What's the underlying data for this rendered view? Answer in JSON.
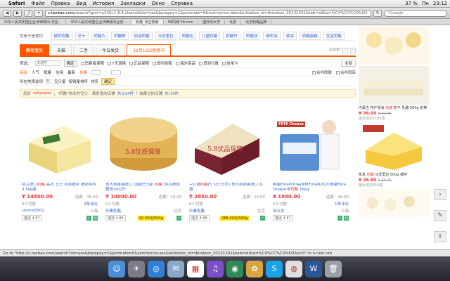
{
  "menubar": {
    "app": "Safari",
    "items": [
      "Файл",
      "Правка",
      "Вид",
      "История",
      "Закладки",
      "Окно",
      "Справка"
    ],
    "status": [
      "37 %",
      "Пн",
      "23:12"
    ]
  },
  "browser": {
    "page_title": "奶酪_淘宝搜索",
    "url_domain": "s.taobao.com",
    "url_rest": "/search?spm=a230r.1.8.6.clzanyl&ds=yes&bprepay=1&promote=0&sort=price-desc&initiative_id=tbindexz_20131201&tab=all&q=%C4%CC%C0%D2",
    "search_placeholder": "Google",
    "tabs": [
      "中华人民共和国企业法律顾问 淘宝...",
      "中华人民共和国企业法律顾问业务...",
      "奶酪_淘宝搜索",
      "58同城 58.com",
      "国外的大学",
      "北京",
      "北京奶酪品牌"
    ]
  },
  "categories": {
    "label": "您是不是想找：",
    "items": [
      "披萨奶酪",
      "芝士",
      "奶酪片",
      "奶酪棒",
      "奶油奶酪",
      "马苏里拉",
      "奶酪包",
      "儿童奶酪",
      "奶酪丹",
      "奶酪球",
      "稀奶油",
      "黄油",
      "奶酪蛋糕",
      "宝宝奶酪"
    ]
  },
  "tabs": {
    "items": [
      "所有宝贝",
      "天猫",
      "二手",
      "今日发货",
      "12月12日购物节"
    ],
    "pager": "1/100"
  },
  "filter1": {
    "label": "筛选：",
    "placeholder": "关键字",
    "ok": "确定",
    "checks": [
      "消费者保障",
      "7天退换",
      "正品保障",
      "即时到账",
      "海外商品",
      "货到付款",
      "信用卡"
    ],
    "select": "全部"
  },
  "filter2": {
    "items": [
      "综合",
      "人气",
      "销量",
      "信用",
      "最新"
    ],
    "price_label": "价格",
    "options": [
      "合并同款",
      "合并同店"
    ]
  },
  "filter3": {
    "label": "所在地筛选项",
    "value": "3",
    "items": [
      "宝贝量",
      "按销量排序",
      "排序"
    ],
    "ok": "确定"
  },
  "notice": {
    "text1": "您好",
    "user": "rallytaker",
    "text2": "，\"奶酪\"相关的宝贝：满意度的店铺",
    "count1": "共计24件",
    "text3": "收藏过的店铺",
    "count2": "共计0件"
  },
  "products": [
    {
      "title_pre": "荷兰进口",
      "title_hl": "奶酪",
      "title_post": " 高达 芝士 拉丝披萨 披萨原料 3.5kg装",
      "price": "¥ 14800.00",
      "shipping": "运费：35.00",
      "sold": "0人付款",
      "reviews": "3条评论",
      "shop": "chenyl0902",
      "location": "上海",
      "rating": "4.87",
      "badge": "",
      "img_text": ""
    },
    {
      "title_pre": "意大利原装进口 顶级巴马臣 ",
      "title_hl": "奶酪",
      "title_post": " 36月熟成 整块24公斤",
      "price": "¥ 10000.00",
      "shipping": "运费：10.00",
      "sold": "0人付款",
      "reviews": "",
      "shop": "乐雅乳酪",
      "location": "北京",
      "rating": "4.88",
      "badge": "92.59元/500g",
      "img_text": "5.8优质保障"
    },
    {
      "title_pre": "+红酒",
      "title_hl": "奶酪",
      "title_post": "(5 公斤左右) 意大利原装进口 红酒",
      "price": "¥ 2850.00",
      "shipping": "运费：10.00",
      "sold": "0人付款",
      "reviews": "",
      "shop": "乐雅乳酪",
      "location": "北京",
      "rating": "4.88",
      "badge": "285.00元/500g",
      "img_text": "5.8优品保障"
    },
    {
      "title_pre": "希腊FetaPDO高等MEVGALIKI大桶装Feta cheese羊",
      "title_hl": "奶酪",
      "title_post": " 16kg",
      "price": "¥ 1980.00",
      "shipping": "运费：44.00",
      "sold": "0人付款",
      "reviews": "1条评论",
      "shop": "何以志",
      "location": "上海",
      "rating": "4.87",
      "badge": "",
      "img_text": "FETA Cheese"
    }
  ],
  "sidebar_ads": [
    {
      "title_pre": "内蒙古 特产零食 ",
      "title_hl": "奶酪",
      "title_post": " 奶干 乳酪 500g 奶棒",
      "price": "¥ 36.00",
      "old_price": "¥ 72.00",
      "sold": "最近成交1183笔"
    },
    {
      "title_pre": "凯发 ",
      "title_hl": "奶酪",
      "title_post": " 马苏里拉 500g 披萨",
      "price": "¥ 26.80",
      "old_price": "¥ 38.00",
      "sold": "最近成交819笔"
    }
  ],
  "statusbar": "Go to \"http://s.taobao.com/search?ds=yes&bprepay=1&promote=0&sort=price-asc&initiative_id=tbindexz_20131201&tab=all&q=%C4%CC%C0%D2&s=0\" in a new tab",
  "dock": [
    "Finder",
    "Launchpad",
    "Safari",
    "Mail",
    "Calendar",
    "iTunes",
    "FaceTime",
    "Photos",
    "Skype",
    "Chrome",
    "Word",
    "Trash"
  ]
}
